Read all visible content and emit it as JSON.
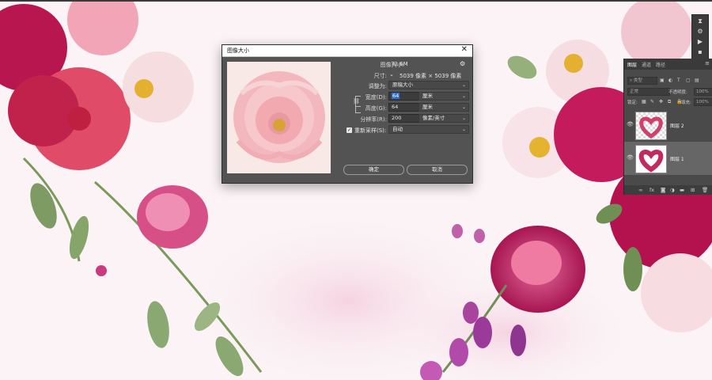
{
  "dialog": {
    "title": "图像大小",
    "close_symbol": "✕",
    "image_size_label": "图像大小:",
    "image_size_value": "72.6M",
    "settings_icon": "gear-icon",
    "dimensions_label": "尺寸:",
    "dimensions_value": "5039 像素 × 5039 像素",
    "fit_to_label": "调整为:",
    "fit_to_value": "原稿大小",
    "width_label": "宽度(D):",
    "width_value": "64",
    "width_unit": "厘米",
    "height_label": "高度(G):",
    "height_value": "64",
    "height_unit": "厘米",
    "resolution_label": "分辨率(R):",
    "resolution_value": "200",
    "resolution_unit": "像素/英寸",
    "resample_label": "重新采样(S):",
    "resample_checked": true,
    "resample_value": "自动",
    "ok_label": "确定",
    "cancel_label": "取消"
  },
  "layers_panel": {
    "tabs": [
      "图层",
      "通道",
      "路径"
    ],
    "filter_placeholder": "类型",
    "blend_mode": "正常",
    "opacity_label": "不透明度:",
    "opacity_value": "100%",
    "lock_label": "锁定:",
    "fill_label": "填充:",
    "fill_value": "100%",
    "layers": [
      {
        "name": "图层 2",
        "visible": true,
        "active": false
      },
      {
        "name": "图层 1",
        "visible": true,
        "active": true
      }
    ]
  },
  "colors": {
    "dialog_bg": "#535353",
    "accent_selection": "#2d6fd1",
    "panel_bg": "#4a4a4a"
  }
}
